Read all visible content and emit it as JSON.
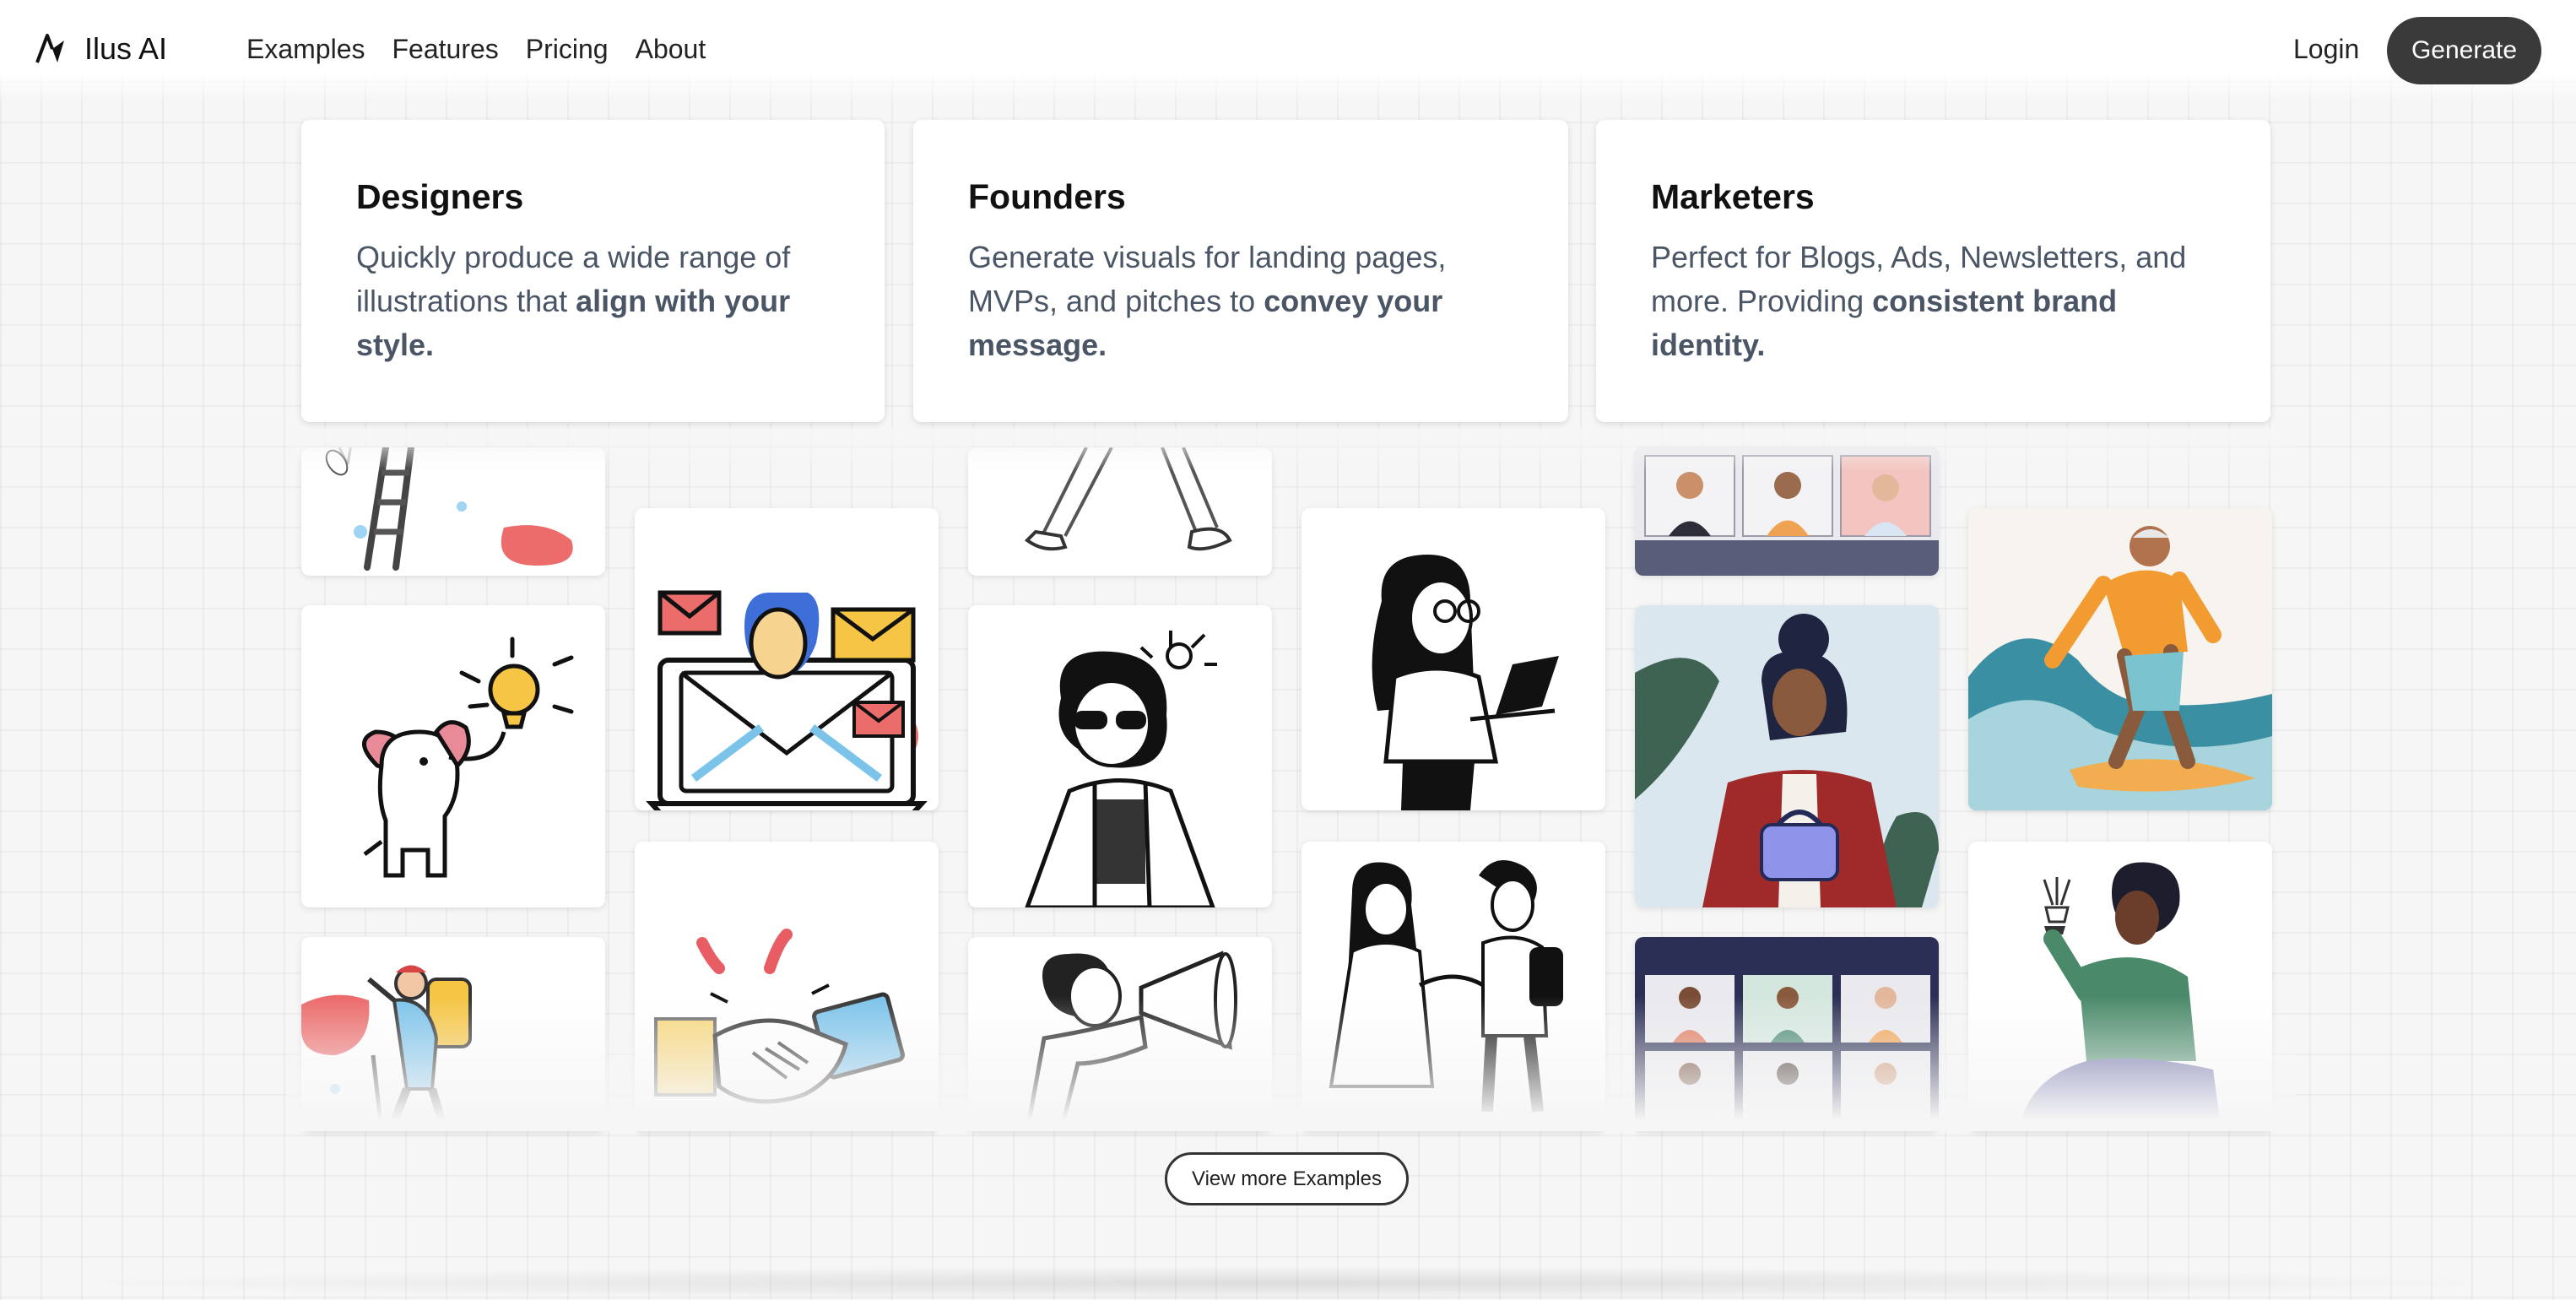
{
  "header": {
    "brand": "Ilus AI",
    "nav": [
      "Examples",
      "Features",
      "Pricing",
      "About"
    ],
    "login_label": "Login",
    "generate_label": "Generate"
  },
  "cards": [
    {
      "title": "Designers",
      "text": "Quickly produce a wide range of illustrations that ",
      "bold": "align with your style."
    },
    {
      "title": "Founders",
      "text": "Generate visuals for landing pages, MVPs, and pitches to ",
      "bold": "convey your message."
    },
    {
      "title": "Marketers",
      "text": "Perfect for Blogs, Ads, Newsletters, and more. Providing ",
      "bold": "consistent brand identity."
    }
  ],
  "gallery": {
    "illustrations": [
      "ladder-illustration",
      "elephant-lightbulb-illustration",
      "climber-illustration",
      "email-laptop-illustration",
      "handshake-illustration",
      "walking-legs-sketch",
      "sunglasses-person-sketch",
      "megaphone-person-sketch",
      "woman-laptop-sketch",
      "handshake-people-sketch",
      "video-call-illustration",
      "woman-red-coat-illustration",
      "video-call-grid-illustration",
      "surfer-illustration",
      "lightbulb-person-illustration"
    ],
    "more_label": "View more Examples"
  },
  "colors": {
    "generate_bg": "#3a3a3a",
    "text_muted": "#4a5565",
    "accent_red": "#e85d63",
    "accent_yellow": "#f5c543",
    "accent_blue": "#7cc3ea"
  }
}
